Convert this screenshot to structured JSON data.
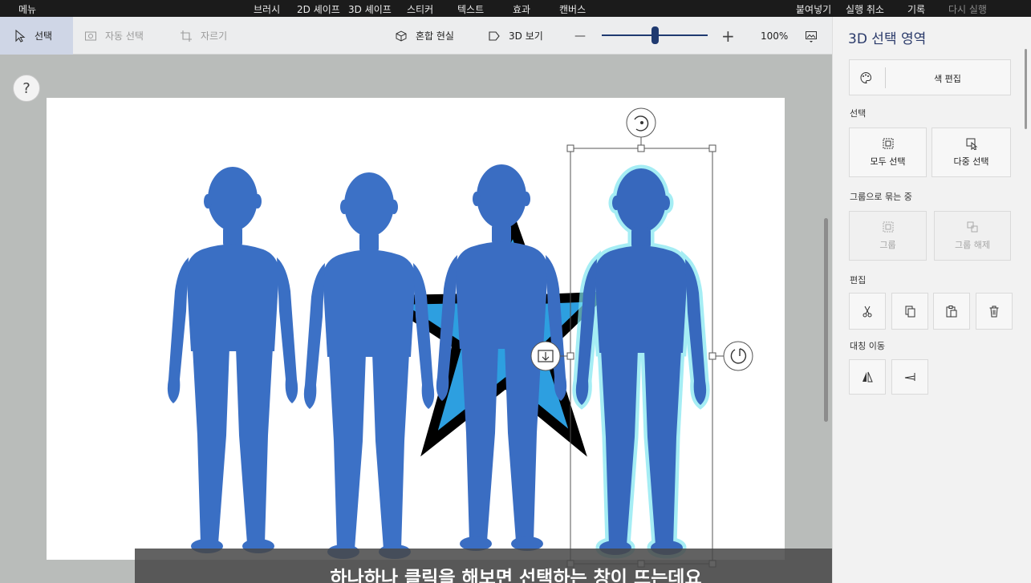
{
  "menubar": {
    "menu": "메뉴",
    "tabs": [
      "브러시",
      "2D 셰이프",
      "3D 셰이프",
      "스티커",
      "텍스트",
      "효과",
      "캔버스"
    ],
    "paste": "붙여넣기",
    "undo": "실행 취소",
    "history": "기록",
    "redo": "다시 실행"
  },
  "toolbar": {
    "select": "선택",
    "magic_select": "자동 선택",
    "crop": "자르기",
    "mixed_reality": "혼합 현실",
    "view_3d": "3D 보기",
    "zoom_minus": "—",
    "zoom_plus": "+",
    "zoom_level": "100%",
    "zoom_fraction": 0.5
  },
  "help": "?",
  "caption": "하나하나 클릭을 해보면 선택하는 창이 뜨는데요",
  "panel": {
    "title": "3D 선택 영역",
    "color_edit": "색 편집",
    "select_section": "선택",
    "select_all": "모두 선택",
    "multi_select": "다중 선택",
    "group_section": "그룹으로 묶는 중",
    "group": "그룹",
    "ungroup": "그룹 해제",
    "edit_section": "편집",
    "mirror_section": "대칭 이동"
  },
  "icons": [
    "cursor-icon",
    "magic-select-icon",
    "crop-icon",
    "mixed-reality-icon",
    "view-3d-icon",
    "image-icon",
    "palette-icon",
    "select-all-icon",
    "multi-select-icon",
    "group-icon",
    "ungroup-icon",
    "cut-icon",
    "copy-icon",
    "paste-icon",
    "trash-icon",
    "flip-horizontal-icon",
    "flip-vertical-icon",
    "rotate-icon",
    "depth-icon",
    "tilt-icon"
  ],
  "colors": {
    "figure": "#3a6fc4",
    "star_fill": "#2d9fe0",
    "accent": "#1f3a70",
    "menubar": "#1b1b1b"
  }
}
